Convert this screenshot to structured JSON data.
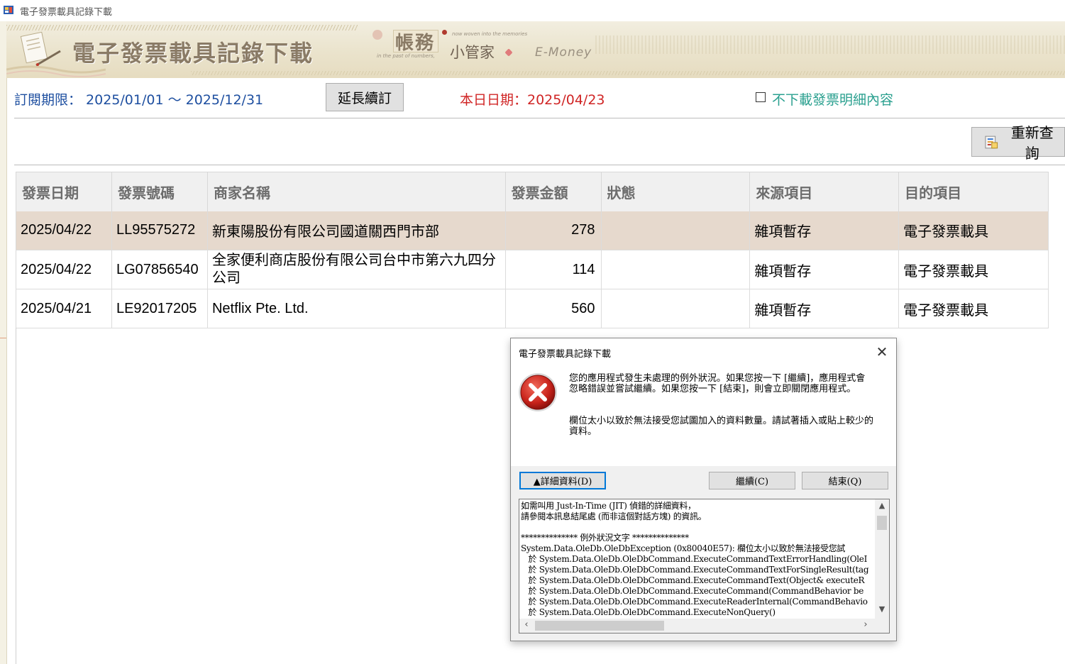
{
  "window": {
    "title": "電子發票載具記錄下載"
  },
  "banner": {
    "title": "電子發票載具記錄下載",
    "logo_main": "帳務",
    "logo_sub": "小管家",
    "logo_tag_1": "now woven into the memories",
    "logo_tag_2": "in the past of numbers,",
    "logo_emoney": "E-Money"
  },
  "info": {
    "subscription_label": "訂閱期限： 2025/01/01 ～ 2025/12/31",
    "extend_button": "延長續訂",
    "today_label": "本日日期：2025/04/23",
    "no_detail_checked": false,
    "no_detail_label": "不下載發票明細內容"
  },
  "toolbar": {
    "requery_button": "重新查詢"
  },
  "table": {
    "columns": [
      "發票日期",
      "發票號碼",
      "商家名稱",
      "發票金額",
      "狀態",
      "來源項目",
      "目的項目"
    ],
    "rows": [
      {
        "date": "2025/04/22",
        "number": "LL95575272",
        "merchant": "新東陽股份有限公司國道關西門市部",
        "amount": "278",
        "status": "",
        "source": "雜項暫存",
        "target": "電子發票載具"
      },
      {
        "date": "2025/04/22",
        "number": "LG07856540",
        "merchant": "全家便利商店股份有限公司台中市第六九四分公司",
        "amount": "114",
        "status": "",
        "source": "雜項暫存",
        "target": "電子發票載具"
      },
      {
        "date": "2025/04/21",
        "number": "LE92017205",
        "merchant": "Netflix Pte. Ltd.",
        "amount": "560",
        "status": "",
        "source": "雜項暫存",
        "target": "電子發票載具"
      }
    ]
  },
  "dialog": {
    "title": "電子發票載具記錄下載",
    "message": "您的應用程式發生未處理的例外狀況。如果您按一下 [繼續]，應用程式會忽略錯誤並嘗試繼續。如果您按一下 [結束]，則會立即關閉應用程式。",
    "detail_message": "欄位太小以致於無法接受您試圖加入的資料數量。請試著插入或貼上較少的資料。",
    "details_button": "▲詳細資料(D)",
    "continue_button": "繼續(C)",
    "quit_button": "結束(Q)",
    "details_text": "如需叫用 Just-In-Time (JIT) 偵錯的詳細資料，\n請參閱本訊息結尾處 (而非這個對話方塊) 的資訊。\n\n************** 例外狀況文字 **************\nSystem.Data.OleDb.OleDbException (0x80040E57): 欄位太小以致於無法接受您試\n   於 System.Data.OleDb.OleDbCommand.ExecuteCommandTextErrorHandling(OleI\n   於 System.Data.OleDb.OleDbCommand.ExecuteCommandTextForSingleResult(tag\n   於 System.Data.OleDb.OleDbCommand.ExecuteCommandText(Object& executeR\n   於 System.Data.OleDb.OleDbCommand.ExecuteCommand(CommandBehavior be\n   於 System.Data.OleDb.OleDbCommand.ExecuteReaderInternal(CommandBehavio\n   於 System.Data.OleDb.OleDbCommand.ExecuteNonQuery()"
  }
}
